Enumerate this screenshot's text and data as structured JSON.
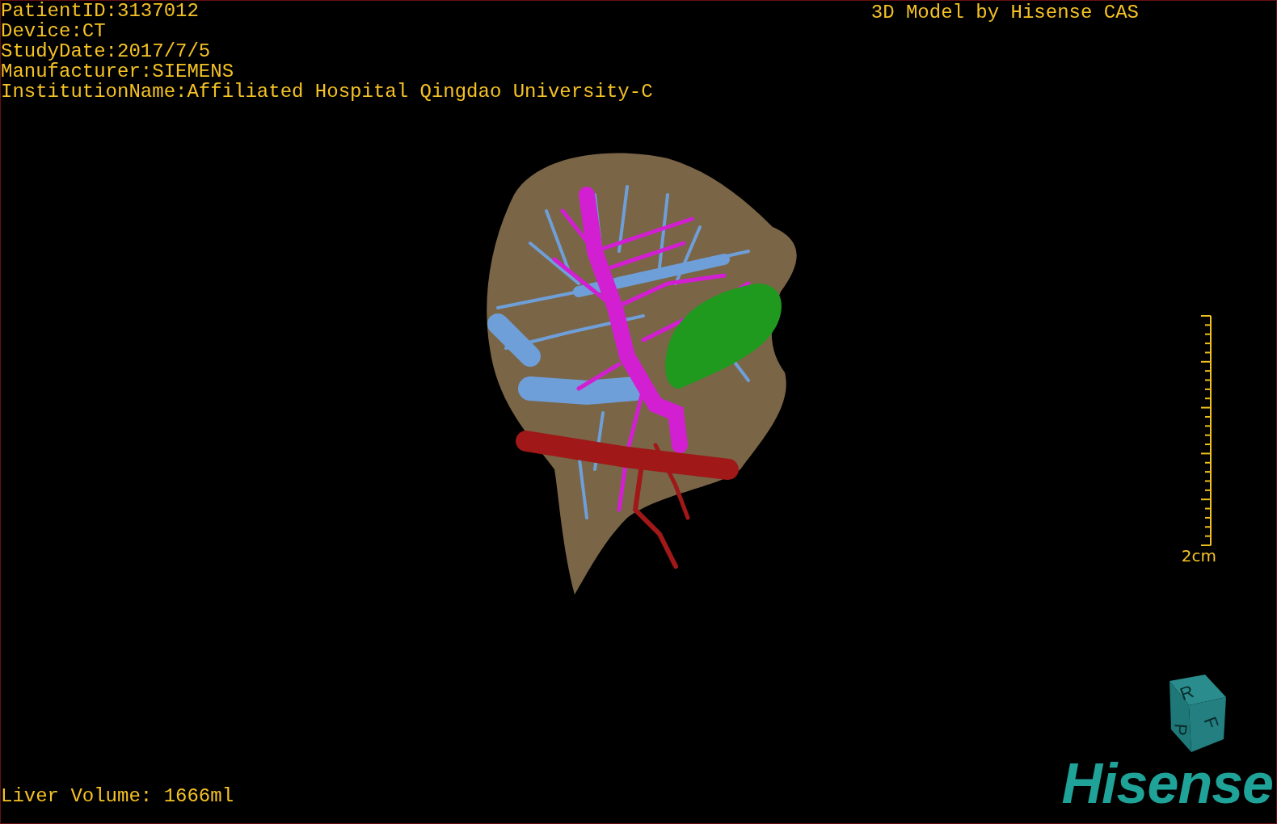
{
  "info_lines": [
    "PatientID:3137012",
    "Device:CT",
    "StudyDate:2017/7/5",
    "Manufacturer:SIEMENS",
    "InstitutionName:Affiliated Hospital Qingdao University-C"
  ],
  "title": "3D Model by Hisense CAS",
  "scale_label": "2cm",
  "volume": "Liver Volume: 1666ml",
  "cube_labels": [
    "R",
    "F",
    "P"
  ],
  "logo": "Hisense"
}
